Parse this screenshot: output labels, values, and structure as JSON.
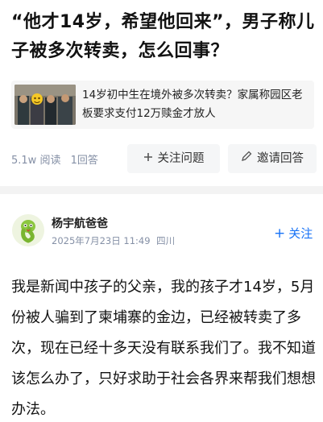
{
  "question": {
    "title": "“他才14岁，希望他回来”，男子称儿子被多次转卖，怎么回事？"
  },
  "news_card": {
    "text": "14岁初中生在境外被多次转卖？家属称园区老板要求支付12万赎金才放人",
    "thumbnail_icon": "news-photo"
  },
  "stats": {
    "views": "5.1w 阅读",
    "answers": "1回答"
  },
  "actions": {
    "follow_question": "关注问题",
    "invite_answer": "邀请回答",
    "follow_icon": "plus-icon",
    "invite_icon": "pencil-icon"
  },
  "answer": {
    "author": "杨宇航爸爸",
    "date": "2025年7月23日 11:49",
    "location": "四川",
    "follow_label": "关注",
    "avatar_icon": "snake-avatar",
    "body": "我是新闻中孩子的父亲，我的孩子才14岁，5月份被人骗到了柬埔寨的金边，已经被转卖了多次，现在已经十多天没有联系我们了。我不知道该怎么办了，只好求助于社会各界来帮我们想想办法。"
  },
  "colors": {
    "accent": "#1772f6",
    "secondary_text": "#8590a6",
    "divider": "#f3f3f3"
  }
}
